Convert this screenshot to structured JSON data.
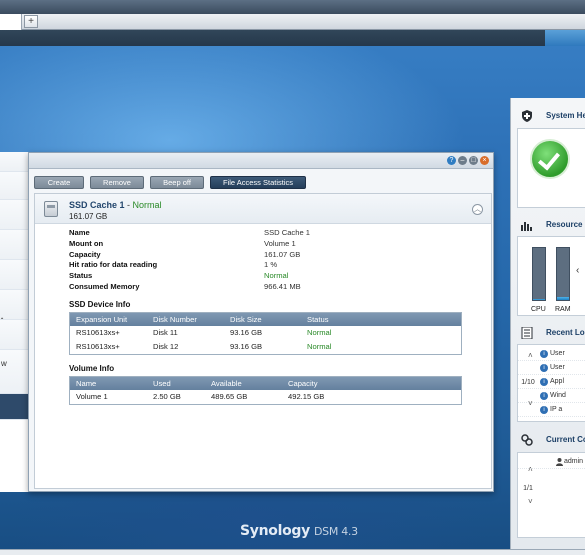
{
  "tabbar": {
    "add_label": "+"
  },
  "leftnav": {
    "items": [
      {
        "label": ""
      },
      {
        "label": ""
      },
      {
        "label": ""
      },
      {
        "label": ""
      },
      {
        "label": ""
      },
      {
        "label": "t"
      },
      {
        "label": ""
      },
      {
        "label": "w"
      },
      {
        "label": ""
      }
    ]
  },
  "window": {
    "controls": {
      "help": "?",
      "min": "–",
      "max": "□",
      "close": "×"
    },
    "toolbar": {
      "create": "Create",
      "remove": "Remove",
      "beep_off": "Beep off",
      "file_access_statistics": "File Access Statistics"
    },
    "cache": {
      "title": "SSD Cache 1",
      "separator": " - ",
      "status": "Normal",
      "size": "161.07 GB",
      "collapse": "︿"
    },
    "properties": [
      {
        "key": "Name",
        "value": "SSD Cache 1"
      },
      {
        "key": "Mount on",
        "value": "Volume 1"
      },
      {
        "key": "Capacity",
        "value": "161.07 GB"
      },
      {
        "key": "Hit ratio for data reading",
        "value": "1 %"
      },
      {
        "key": "Status",
        "value": "Normal"
      },
      {
        "key": "Consumed Memory",
        "value": "966.41 MB"
      }
    ],
    "ssd_device_info": {
      "title": "SSD Device Info",
      "columns": [
        "Expansion Unit",
        "Disk Number",
        "Disk Size",
        "Status"
      ],
      "rows": [
        [
          "RS10613xs+",
          "Disk 11",
          "93.16 GB",
          "Normal"
        ],
        [
          "RS10613xs+",
          "Disk 12",
          "93.16 GB",
          "Normal"
        ]
      ]
    },
    "volume_info": {
      "title": "Volume Info",
      "columns": [
        "Name",
        "Used",
        "Available",
        "Capacity"
      ],
      "rows": [
        [
          "Volume 1",
          "2.50 GB",
          "489.65 GB",
          "492.15 GB"
        ]
      ]
    }
  },
  "widgets": {
    "system_health": {
      "title": "System He"
    },
    "resource": {
      "title": "Resource",
      "cpu": "CPU",
      "ram": "RAM",
      "cpu_level": 0.02,
      "ram_level": 0.05
    },
    "recent_logs": {
      "title": "Recent Lo",
      "pager": "1/10",
      "items": [
        "User",
        "User",
        "Appl",
        "Wind",
        "IP a"
      ]
    },
    "current_connections": {
      "title": "Current Co",
      "pager": "1/1",
      "items": [
        "admin"
      ]
    }
  },
  "branding": {
    "brand": "Synology",
    "version": "DSM 4.3"
  }
}
